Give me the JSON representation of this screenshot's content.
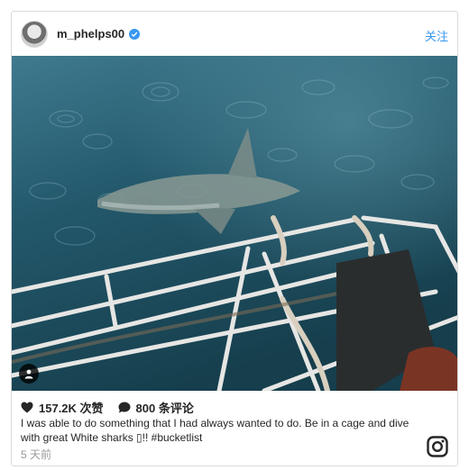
{
  "post": {
    "username": "m_phelps00",
    "follow_label": "关注",
    "likes": "157.2K 次赞",
    "comments": "800 条评论",
    "caption": "I was able to do something that I had always wanted to do. Be in a cage and dive with great White sharks ▯!! #bucketlist",
    "time": "5 天前"
  },
  "icons": {
    "verified": "verified-badge-icon",
    "like": "heart-icon",
    "comment": "comment-bubble-icon",
    "tag": "person-tag-icon",
    "brand": "instagram-logo-icon"
  },
  "colors": {
    "accent": "#3897f0",
    "water": "#1f4a5c",
    "muted_text": "#999999"
  }
}
